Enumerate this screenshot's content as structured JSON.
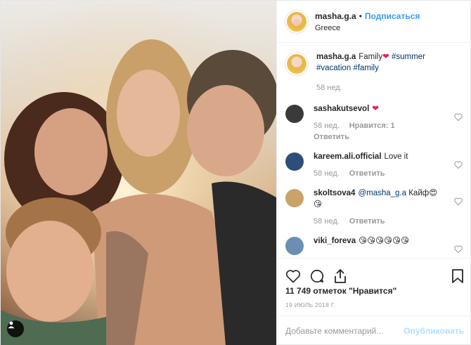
{
  "header": {
    "username": "masha.g.a",
    "separator": "•",
    "follow_label": "Подписаться",
    "location": "Greece"
  },
  "caption": {
    "username": "masha.g.a",
    "text": "Family",
    "heart": "❤",
    "tags": [
      "#summer",
      "#vacation",
      "#family"
    ],
    "time": "58 нед."
  },
  "comments": [
    {
      "username": "sashakutsevol",
      "text": "❤",
      "time": "58 нед.",
      "likes": "Нравится: 1",
      "reply": "Ответить",
      "avatar_color": "#3a3a3a"
    },
    {
      "username": "kareem.ali.official",
      "text": "Love it",
      "time": "58 нед.",
      "reply": "Ответить",
      "avatar_color": "#2d4d7a"
    },
    {
      "username": "skoltsova4",
      "mention": "@masha_g.a",
      "text": "Кайф😍😘",
      "time": "58 нед.",
      "reply": "Ответить",
      "avatar_color": "#c9a36a"
    },
    {
      "username": "viki_foreva",
      "text": "😘😘😘😘😘😘",
      "avatar_color": "#6b8fb3"
    }
  ],
  "likes_text": "11 749 отметок \"Нравится\"",
  "date": "19 ИЮЛЬ 2018 Г.",
  "comment_input": {
    "placeholder": "Добавьте комментарий...",
    "value": ""
  },
  "publish_label": "Опубликовать",
  "colors": {
    "link": "#3897f0",
    "hashtag": "#003569",
    "muted": "#999999",
    "heart": "#e0245e"
  },
  "icons": [
    "user-tag-icon",
    "like-icon",
    "comment-icon",
    "share-icon",
    "save-icon",
    "small-heart-icon"
  ]
}
